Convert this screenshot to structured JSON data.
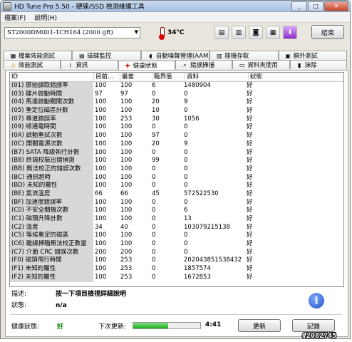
{
  "window": {
    "title": "HD Tune Pro 5.50 - 硬碟/SSD 檢測維護工具",
    "min": "_",
    "max": "□",
    "close": "✕"
  },
  "menu": [
    "檔案(F)",
    "說明(H)"
  ],
  "toolbar": {
    "drive": "ST2000DM001-1CH164 (2000 gB)",
    "temperature": "34℃",
    "exit_label": "結束"
  },
  "tabs_row1": [
    {
      "label": "檔案效能測試",
      "icon": "file-benchmark-icon",
      "glyph": "▦"
    },
    {
      "label": "磁碟監控",
      "icon": "disk-monitor-icon",
      "glyph": "▤"
    },
    {
      "label": "自動噪聲管理(AAM)",
      "icon": "speaker-icon",
      "glyph": "◖"
    },
    {
      "label": "隨機存取",
      "icon": "random-access-icon",
      "glyph": "▥"
    },
    {
      "label": "額外測試",
      "icon": "extra-tests-icon",
      "glyph": "▣"
    }
  ],
  "tabs_row2": [
    {
      "label": "效能測試",
      "icon": "benchmark-icon",
      "glyph": "⚠"
    },
    {
      "label": "資訊",
      "icon": "info-tab-icon",
      "glyph": "ⅰ"
    },
    {
      "label": "健康狀態",
      "icon": "health-cross-icon",
      "glyph": "✚"
    },
    {
      "label": "錯誤掃描",
      "icon": "error-scan-icon",
      "glyph": "⌕"
    },
    {
      "label": "資料夾使用",
      "icon": "folder-usage-icon",
      "glyph": "▭"
    },
    {
      "label": "抹除",
      "icon": "erase-icon",
      "glyph": "▮"
    }
  ],
  "active_tab": "健康狀態",
  "columns": [
    "ID",
    "目前...",
    "最差",
    "臨界值",
    "資料",
    "狀態"
  ],
  "rows": [
    [
      "(01) 原始讀取錯誤率",
      "100",
      "100",
      "6",
      "1480904",
      "好"
    ],
    [
      "(03) 碟片啟動時間",
      "97",
      "97",
      "0",
      "0",
      "好"
    ],
    [
      "(04) 馬達啟動關閉次數",
      "100",
      "100",
      "20",
      "9",
      "好"
    ],
    [
      "(05) 重定位磁區計數",
      "100",
      "100",
      "10",
      "0",
      "好"
    ],
    [
      "(07) 尋道錯誤率",
      "100",
      "253",
      "30",
      "1056",
      "好"
    ],
    [
      "(09) 總通電時間",
      "100",
      "100",
      "0",
      "0",
      "好"
    ],
    [
      "(0A) 啟動重試次數",
      "100",
      "100",
      "97",
      "0",
      "好"
    ],
    [
      "(0C) 開關電源次數",
      "100",
      "100",
      "20",
      "9",
      "好"
    ],
    [
      "(B7) SATA 降級執行計數",
      "100",
      "100",
      "0",
      "0",
      "好"
    ],
    [
      "(B8) 終端校驗出錯偵測",
      "100",
      "100",
      "99",
      "0",
      "好"
    ],
    [
      "(BB) 無法校正的錯誤次數",
      "100",
      "100",
      "0",
      "0",
      "好"
    ],
    [
      "(BC) 通訊超時",
      "100",
      "100",
      "0",
      "0",
      "好"
    ],
    [
      "(BD) 未知的屬性",
      "100",
      "100",
      "0",
      "0",
      "好"
    ],
    [
      "(BE) 氣流溫度",
      "66",
      "66",
      "45",
      "572522530",
      "好"
    ],
    [
      "(BF) 加速度錯誤率",
      "100",
      "100",
      "0",
      "0",
      "好"
    ],
    [
      "(C0) 不安全關機次數",
      "100",
      "100",
      "0",
      "6",
      "好"
    ],
    [
      "(C1) 磁頭升降計數",
      "100",
      "100",
      "0",
      "13",
      "好"
    ],
    [
      "(C2) 溫度",
      "34",
      "40",
      "0",
      "103079215138",
      "好"
    ],
    [
      "(C5) 等候重定的磁區",
      "100",
      "100",
      "0",
      "0",
      "好"
    ],
    [
      "(C6) 離線掃瞄無法校正數量",
      "100",
      "100",
      "0",
      "0",
      "好"
    ],
    [
      "(C7) 介面 CRC 錯誤次數",
      "200",
      "200",
      "0",
      "0",
      "好"
    ],
    [
      "(F0) 磁頭飛行時間",
      "100",
      "253",
      "0",
      "202043851538432",
      "好"
    ],
    [
      "(F1) 未知的屬性",
      "100",
      "253",
      "0",
      "1857574",
      "好"
    ],
    [
      "(F2) 未知的屬性",
      "100",
      "253",
      "0",
      "1672853",
      "好"
    ]
  ],
  "description": {
    "desc_label": "描述:",
    "desc_value": "按一下項目檢視詳細說明",
    "status_label": "狀態:",
    "status_value": "n/a"
  },
  "footer": {
    "health_label": "健康狀態:",
    "health_value": "好",
    "next_update_label": "下次更新:",
    "progress": 0.52,
    "time": "4:41",
    "update_btn": "更新",
    "log_btn": "記錄"
  },
  "watermark": "#2082745",
  "colors": {
    "good": "#0a8a0a",
    "accent": "#1f4fc7"
  }
}
